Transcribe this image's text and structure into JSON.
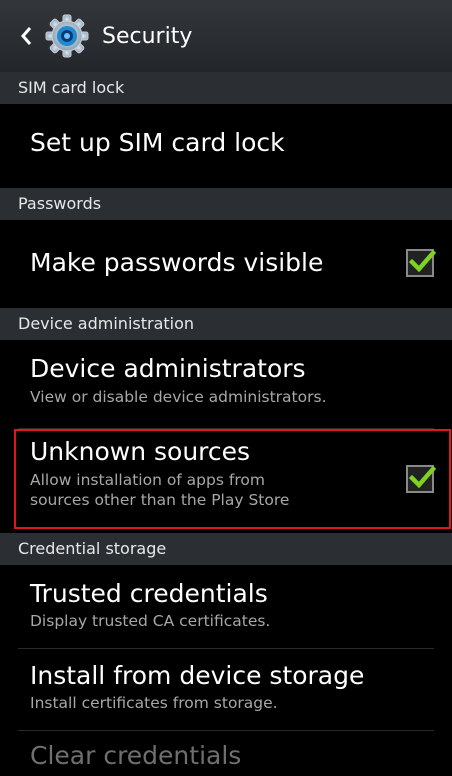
{
  "header": {
    "title": "Security",
    "back_icon": "chevron-left-icon",
    "app_icon": "gear-icon"
  },
  "sections": {
    "sim": "SIM card lock",
    "passwords": "Passwords",
    "device_admin": "Device administration",
    "credentials": "Credential storage"
  },
  "items": {
    "sim_lock": {
      "title": "Set up SIM card lock"
    },
    "passwords_visible": {
      "title": "Make passwords visible",
      "checked": true
    },
    "device_admins": {
      "title": "Device administrators",
      "subtitle": "View or disable device administrators."
    },
    "unknown_sources": {
      "title": "Unknown sources",
      "subtitle_line1": "Allow installation of apps from",
      "subtitle_line2": "sources other than the Play Store",
      "checked": true
    },
    "trusted_creds": {
      "title": "Trusted credentials",
      "subtitle": "Display trusted CA certificates."
    },
    "install_storage": {
      "title": "Install from device storage",
      "subtitle": "Install certificates from storage."
    },
    "clear_creds": {
      "title": "Clear credentials"
    }
  },
  "colors": {
    "check": "#7ed321",
    "highlight_border": "#e0161d",
    "section_bg": "#2b2f33",
    "disabled_text": "#6f6f6f"
  }
}
